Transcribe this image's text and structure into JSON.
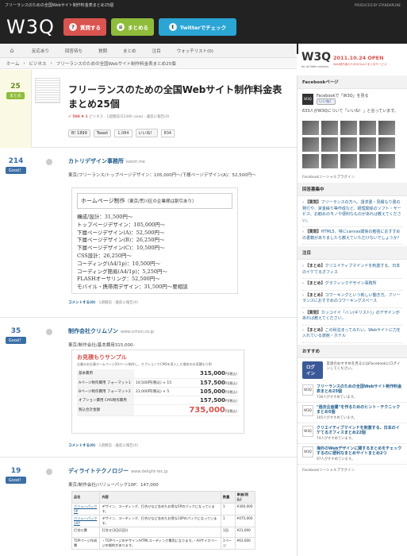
{
  "header": {
    "tagline": "フリーランスのための全国Webサイト制作料金表まとめ25個",
    "produced_by": "PRODUCED BY STANDHPLINE",
    "logo": "W3Q",
    "buttons": {
      "question": "質問する",
      "summary": "まとめる",
      "twitter": "Twitterでチェック"
    }
  },
  "nav": {
    "items": [
      "反応あり",
      "回答待ち",
      "質問",
      "まとめ",
      "注目",
      "ウォッチリスト(0)"
    ]
  },
  "breadcrumb": [
    "ホーム",
    "ビジネス",
    "フリーランスのための全国Webサイト制作料金表まとめ25個"
  ],
  "side_logo": {
    "logo": "W3Q",
    "sub": "for all Web creators",
    "open": "2011.10.24 OPEN",
    "open_sub": "Web制作者のためのQ&A+まとめサービス"
  },
  "question": {
    "count": "25",
    "label": "まとめ",
    "title": "フリーランスのための全国Webサイト制作料金表まとめ25個",
    "meta_count": "508",
    "meta_minus": "1",
    "meta_rest": "ビジネス · 1週間前(52390 view) · 違反に報告(0)",
    "shares": {
      "hatena": "1899",
      "tweet": "Tweet",
      "tweet_count": "1,084",
      "like": "いいね！",
      "like_count": "834"
    }
  },
  "answers": [
    {
      "count": "214",
      "good": "Good！",
      "title": "カトリデザイン事務所",
      "url": "katori.me",
      "desc": "東京/フリーランス/トップページデザイン：105,000円〜/下層ページデザイン(A)：52,500円〜",
      "foot_cm": "コメントする(0)",
      "foot": "1週間前 · 違反に報告(0)"
    },
    {
      "count": "35",
      "good": "Good！",
      "title": "制作会社クリムゾン",
      "url": "www.crmsn.co.jp",
      "desc": "東京/制作会社/基本費用315,000-",
      "foot_cm": "コメントする(0)",
      "foot": "1週間前 · 違反に報告(0)"
    },
    {
      "count": "19",
      "good": "Good！",
      "title": "ディライトテクノロジー",
      "url": "www.delight-tec.jp",
      "desc": "東京/制作会社/バリューパック10P：147,000"
    }
  ],
  "pricebox": {
    "heading": "ホームページ制作",
    "heading_small": "（東京/荒川区の企業様は割引あり）",
    "lines": [
      "構成/設計：31,500円〜",
      "トップページデザイン：105,000円〜",
      "下層ページデザイン(A)：52,500円〜",
      "下層ページデザイン(B)：26,250円〜",
      "下層ページデザイン(C)：10,500円〜",
      "CSS設計：26,250円〜",
      "コーディング(A4/1p)：10,500円〜",
      "コーディング簡易(A4/1p)：5,250円〜",
      "FLASHオーサリング：52,500円〜",
      "モバイル・携帯用デザイン：31,500円〜要相談"
    ]
  },
  "quote": {
    "title": "お見積もりサンプル",
    "sub": "企業のお仕事ホームページ20ページ制作し、オプションでCMSを導入した場合のお見積もり例",
    "rows": [
      {
        "label": "基本費用",
        "calc": "",
        "price": "315,000",
        "unit": "円(税込)"
      },
      {
        "label": "Aページ制作費用 フォーマット1",
        "calc": "10,500円(税込) × 15",
        "price": "157,500",
        "unit": "円(税込)"
      },
      {
        "label": "Bページ制作費用 フォーマット2",
        "calc": "21,000円(税込) × 5",
        "price": "105,000",
        "unit": "円(税込)"
      },
      {
        "label": "オプション費用 CMS制作費用",
        "calc": "",
        "price": "157,500",
        "unit": "円(税込)"
      }
    ],
    "total_label": "税込合計金額",
    "total": "735,000",
    "total_unit": "円(税込)"
  },
  "ptable": {
    "headers": [
      "品名",
      "内容",
      "数量",
      "単価(税込)"
    ],
    "rows": [
      {
        "name": "バリューパック5P",
        "desc": "デザイン、コーディング、打合せなど含めたお得な5Pのパックになっています。",
        "qty": "1",
        "price": "¥300,000"
      },
      {
        "name": "バリューパック10P",
        "desc": "デザイン、コーディング、打合せなど含めたお得な10Pのパックになっています。",
        "qty": "1",
        "price": "¥475,000"
      },
      {
        "name": "打合せ費",
        "desc": "打合せ(2回(1回))",
        "qty": "1回",
        "price": "¥21,000"
      },
      {
        "name": "TOPページ作成費",
        "desc": "・TOPページのデザイン/HTMLコーディング費用になります。・A4サイズページの制約があります。",
        "qty": "1ページ",
        "price": "¥63,000"
      }
    ]
  },
  "sidebar": {
    "fb_head": "Facebookページ",
    "fb_page": "Facebookで「W3Q」を見る",
    "fb_like": "いいね！",
    "fb_count": "633人がW3Qについて「いいね！」と言っています。",
    "fb_plugin": "Facebookソーシャルプラグイン",
    "waiting_head": "回答募集中",
    "waiting": [
      {
        "tag": "【質問】",
        "text": "フリーランスの方へ。請求書・見積もり書の発行や、資金繰り等作成など、経理関係のソフト・サービス、お勧めのモノや便利なものがあれば教えてください。"
      },
      {
        "tag": "【質問】",
        "text": "HTML5、特にcanvas関係の勉強におすすめの書籍がありましたら教えていただけないでしょうか？"
      }
    ],
    "attention_head": "注目",
    "attention": [
      {
        "tag": "【まとめ】",
        "text": "クリエイティブマインドを刺激する、日本のイケてるオフィス"
      },
      {
        "tag": "【まとめ】",
        "text": "グラフィックデザイン事務所"
      },
      {
        "tag": "【まとめ】",
        "text": "コワーキングという新しい働き方。フリーランスにおすすめのコワーキングスペース"
      },
      {
        "tag": "【質問】",
        "text": "カッコイイ「バン(ギリスト)」のデザインがあれば教えてください。"
      },
      {
        "tag": "【まとめ】",
        "text": "この秋泊まってみたい。Webサイトに力を入れている旅館・ホテル"
      }
    ],
    "recommend_head": "おすすめ",
    "login_btn": "ログイン",
    "login_text": "友達のおすすめを見るにはFacebookにログインしてください。",
    "recs": [
      {
        "t": "フリーランスのための全国Webサイト制作料金表まとめ25個",
        "s": "736人がすすめています。"
      },
      {
        "t": "\"過去企画書\"を作るためのヒント・テクニックまとめ5個",
        "s": "105人がすすめています。"
      },
      {
        "t": "クリエイティブマインドを刺激する、日本のイケてるオフィスまとめ22個",
        "s": "74人がすすめています。"
      },
      {
        "t": "海外のWebデザインに関するまとめをチェックするのに便利なまとめサイトまとめ2つ",
        "s": "97人がすすめています。"
      }
    ],
    "rec_icon": "W3Q",
    "plugin": "Facebookソーシャルプラグイン"
  },
  "colors": {
    "red": "#d9534f",
    "green": "#8fbc3a",
    "blue": "#2ba5d4",
    "link": "#1e5c8c"
  }
}
